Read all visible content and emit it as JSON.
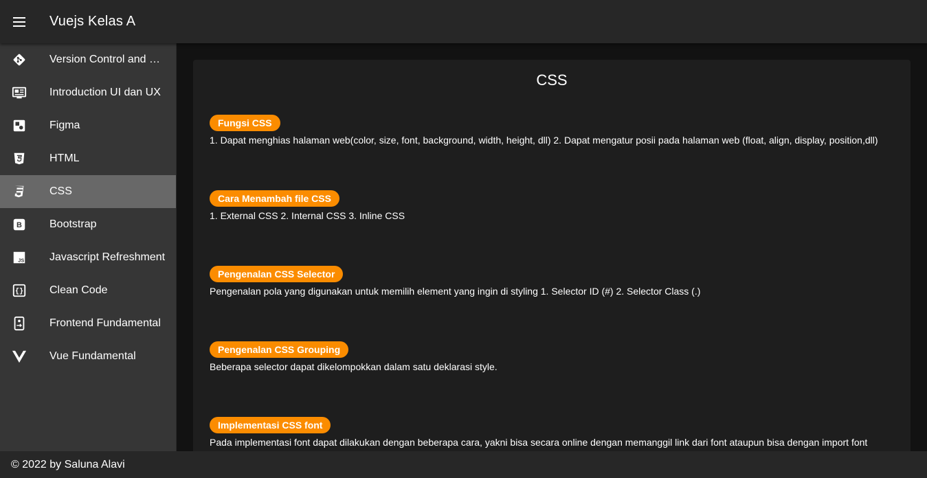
{
  "app": {
    "title": "Vuejs Kelas A"
  },
  "sidebar": {
    "items": [
      {
        "label": "Version Control and Branching",
        "icon": "git-icon"
      },
      {
        "label": "Introduction UI dan UX",
        "icon": "newspaper-icon"
      },
      {
        "label": "Figma",
        "icon": "figma-icon"
      },
      {
        "label": "HTML",
        "icon": "html5-icon"
      },
      {
        "label": "CSS",
        "icon": "css3-icon",
        "active": true
      },
      {
        "label": "Bootstrap",
        "icon": "bootstrap-icon"
      },
      {
        "label": "Javascript Refreshment",
        "icon": "javascript-icon"
      },
      {
        "label": "Clean Code",
        "icon": "code-braces-icon"
      },
      {
        "label": "Frontend Fundamental",
        "icon": "cellphone-arrow-icon"
      },
      {
        "label": "Vue Fundamental",
        "icon": "vuejs-icon"
      }
    ]
  },
  "main": {
    "title": "CSS",
    "sections": [
      {
        "chip": "Fungsi CSS",
        "text": "1. Dapat menghias halaman web(color, size, font, background, width, height, dll) 2. Dapat mengatur posii pada halaman web (float, align, display, position,dll)"
      },
      {
        "chip": "Cara Menambah file CSS",
        "text": "1. External CSS 2. Internal CSS 3. Inline CSS"
      },
      {
        "chip": "Pengenalan CSS Selector",
        "text": "Pengenalan pola yang digunakan untuk memilih element yang ingin di styling 1. Selector ID (#) 2. Selector Class (.)"
      },
      {
        "chip": "Pengenalan CSS Grouping",
        "text": "Beberapa selector dapat dikelompokkan dalam satu deklarasi style."
      },
      {
        "chip": "Implementasi CSS font",
        "text": "Pada implementasi font dapat dilakukan dengan beberapa cara, yakni bisa secara online dengan memanggil link dari font ataupun bisa dengan import font"
      }
    ]
  },
  "footer": {
    "text": "© 2022 by Saluna Alavi"
  },
  "colors": {
    "appbar": "#272727",
    "drawer": "#363636",
    "active_item": "#686868",
    "chip": "#fb8c00",
    "card": "#1e1e1e"
  }
}
